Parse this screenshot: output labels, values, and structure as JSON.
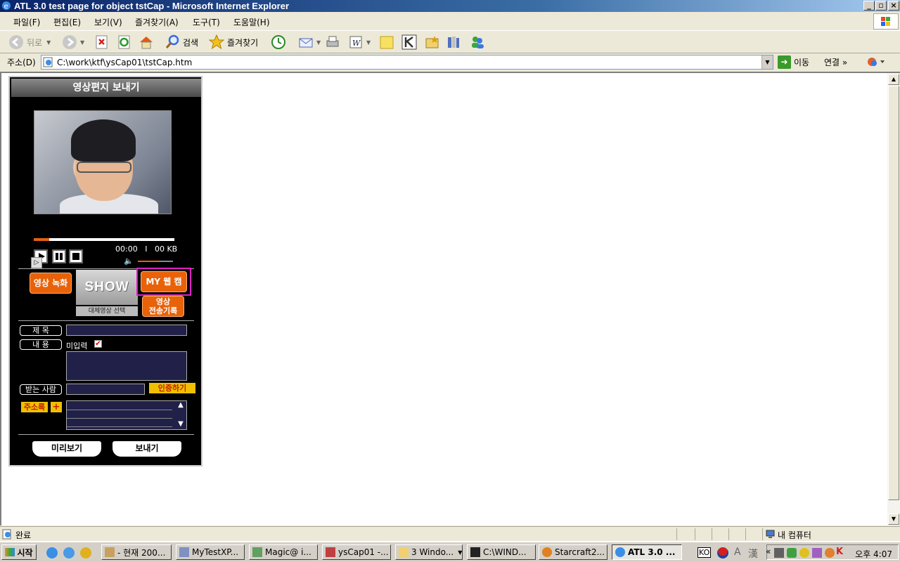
{
  "window": {
    "title": "ATL 3.0 test page for object tstCap - Microsoft Internet Explorer",
    "controls": {
      "minimize": "_",
      "restore": "▫",
      "close": "×"
    }
  },
  "menu": [
    "파일(F)",
    "편집(E)",
    "보기(V)",
    "즐겨찾기(A)",
    "도구(T)",
    "도움말(H)"
  ],
  "toolbar": {
    "back": "뒤로",
    "search": "검색",
    "favorites": "즐겨찾기"
  },
  "address": {
    "label": "주소(D)",
    "value": "C:\\work\\ktf\\ysCap01\\tstCap.htm",
    "go": "이동",
    "links": "연결",
    "links_more": "»"
  },
  "widget": {
    "title": "영상편지 보내기",
    "progress": 0.11,
    "time": "00:00",
    "divider": "I",
    "size": "00 KB",
    "volume": 0.6,
    "record_button": "영상 녹화",
    "show_logo": "SHOW",
    "show_caption": "대체영상 선택",
    "mywebcam_button": "MY 웹 캠",
    "history_button_line1": "영상",
    "history_button_line2": "전송기록",
    "subject_label": "제  목",
    "content_label": "내  용",
    "unentered": "미입력",
    "recipient_label": "받는 사람",
    "auth_button": "인증하기",
    "addressbook_button": "주소록",
    "add_symbol": "+",
    "preview_button": "미리보기",
    "send_button": "보내기"
  },
  "status": {
    "text": "완료",
    "zone": "내 컴퓨터"
  },
  "taskbar": {
    "start": "시작",
    "tasks": [
      {
        "label": "- 현재 200..."
      },
      {
        "label": "MyTestXP..."
      },
      {
        "label": "Magic@ i..."
      },
      {
        "label": "ysCap01 -..."
      },
      {
        "label": "3 Windo..."
      },
      {
        "label": "C:\\WIND..."
      },
      {
        "label": "Starcraft2..."
      },
      {
        "label": "ATL 3.0 ..."
      }
    ],
    "tray": {
      "lang": "KO",
      "ime_a": "A",
      "ime_han": "漢",
      "expand": "«"
    },
    "clock": "오후 4:07"
  },
  "colors": {
    "accent_orange": "#e8620a",
    "highlight_magenta": "#e020c8",
    "panel_bg": "#000000",
    "input_bg": "#202048"
  }
}
